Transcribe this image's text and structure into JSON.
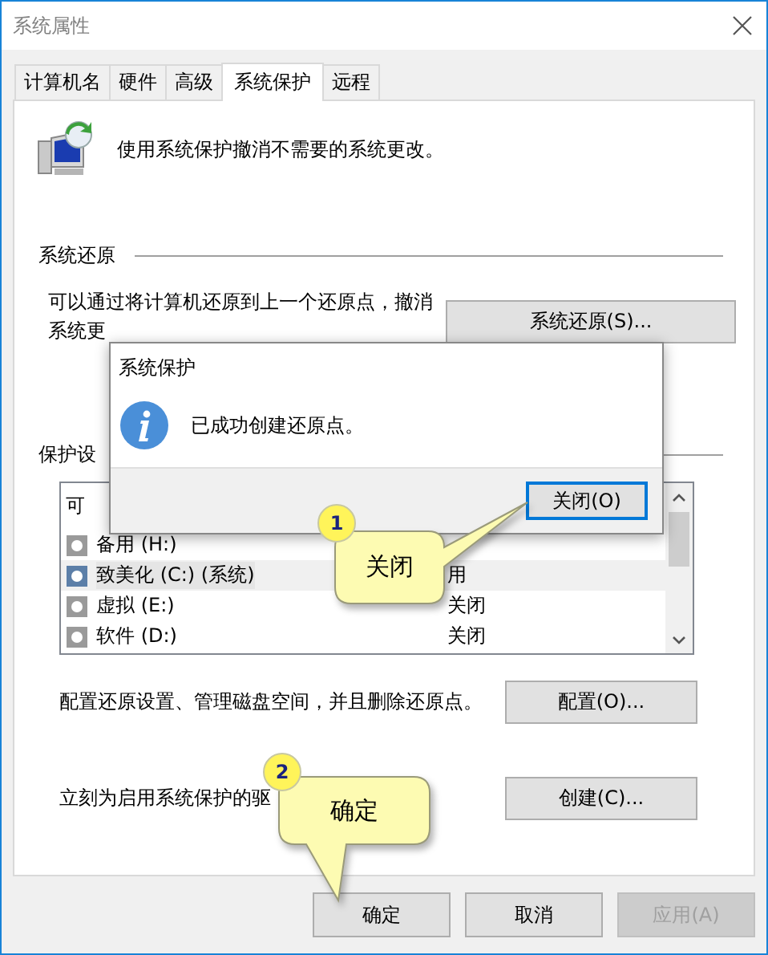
{
  "window": {
    "title": "系统属性"
  },
  "tabs": [
    {
      "label": "计算机名",
      "selected": false
    },
    {
      "label": "硬件",
      "selected": false
    },
    {
      "label": "高级",
      "selected": false
    },
    {
      "label": "系统保护",
      "selected": true
    },
    {
      "label": "远程",
      "selected": false
    }
  ],
  "header": {
    "text": "使用系统保护撤消不需要的系统更改。"
  },
  "system_restore": {
    "heading": "系统还原",
    "description": "可以通过将计算机还原到上一个还原点，撤消系统更",
    "button": "系统还原(S)..."
  },
  "protection": {
    "heading": "保护设",
    "column_1": "可",
    "drives": [
      {
        "name": "备用 (H:)",
        "selected": false
      },
      {
        "name": "致美化 (C:) (系统)",
        "status": "用",
        "selected": true
      },
      {
        "name": "虚拟 (E:)",
        "status": "关闭",
        "selected": false
      },
      {
        "name": "软件 (D:)",
        "status": "关闭",
        "selected": false
      }
    ]
  },
  "configure": {
    "text": "配置还原设置、管理磁盘空间，并且删除还原点。",
    "button": "配置(O)..."
  },
  "create": {
    "text": "立刻为启用系统保护的驱",
    "button": "创建(C)..."
  },
  "buttons": [
    {
      "label": "确定",
      "disabled": false
    },
    {
      "label": "取消",
      "disabled": false
    },
    {
      "label": "应用(A)",
      "disabled": true
    }
  ],
  "dialog": {
    "title": "系统保护",
    "message": "已成功创建还原点。",
    "button": {
      "label": "关闭(O)",
      "focused": true
    }
  },
  "callouts": [
    {
      "number": "1",
      "text": "关闭"
    },
    {
      "number": "2",
      "text": "确定"
    }
  ]
}
